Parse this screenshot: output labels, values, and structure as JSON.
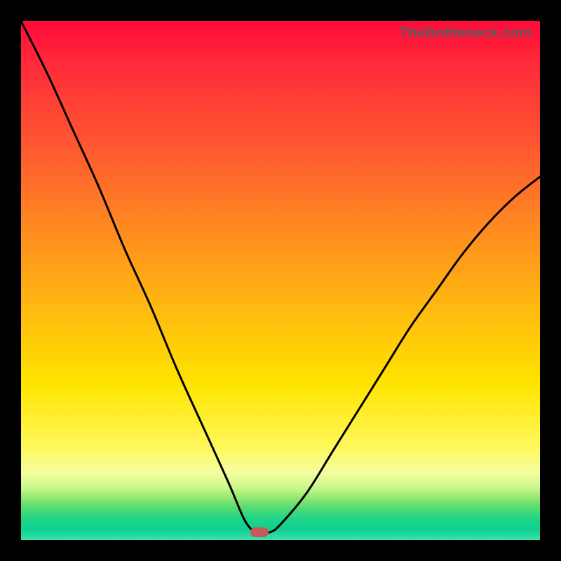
{
  "watermark": "TheBottleneck.com",
  "colors": {
    "marker": "#c65a5a",
    "curve": "#000000"
  },
  "chart_data": {
    "type": "line",
    "title": "",
    "xlabel": "",
    "ylabel": "",
    "xlim": [
      0,
      100
    ],
    "ylim": [
      0,
      100
    ],
    "grid": false,
    "legend": false,
    "valley_x": 46,
    "marker": {
      "x": 46,
      "y": 1.5
    },
    "series": [
      {
        "name": "bottleneck-curve",
        "x": [
          0,
          5,
          10,
          15,
          20,
          25,
          30,
          35,
          40,
          43,
          45,
          46,
          48,
          50,
          55,
          60,
          65,
          70,
          75,
          80,
          85,
          90,
          95,
          100
        ],
        "y": [
          100,
          90,
          79,
          68,
          56,
          45,
          33,
          22,
          11,
          4,
          1.5,
          1.5,
          1.5,
          3,
          9,
          17,
          25,
          33,
          41,
          48,
          55,
          61,
          66,
          70
        ]
      }
    ],
    "annotations": []
  }
}
